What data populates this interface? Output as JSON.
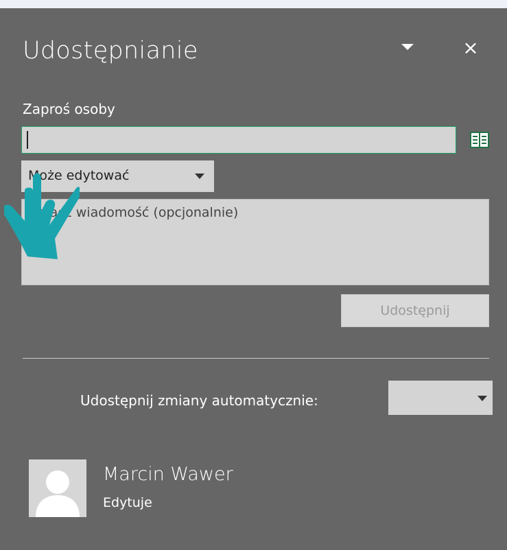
{
  "pane": {
    "title": "Udostępnianie",
    "title_dropdown_icon": "triangle-down",
    "close_icon": "close-x",
    "close_label": "×"
  },
  "invite": {
    "label": "Zaproś osoby",
    "input_value": "",
    "address_book_icon": "address-book"
  },
  "permission": {
    "selected": "Może edytować",
    "visible_text": "Może edytować"
  },
  "message": {
    "placeholder": "Dołącz wiadomość (opcjonalnie)",
    "visible_text": "z wiadomość (opcjonalnie)"
  },
  "share_button": {
    "label": "Udostępnij"
  },
  "auto_share": {
    "label": "Udostępnij zmiany automatycznie:",
    "selected": ""
  },
  "users": [
    {
      "name": "Marcin Wawer",
      "role": "Edytuje"
    }
  ],
  "colors": {
    "pane_bg": "#666666",
    "input_bg": "#d4d4d4",
    "input_border_accent": "#21a366",
    "cursor_hand": "#1aa5ae"
  }
}
